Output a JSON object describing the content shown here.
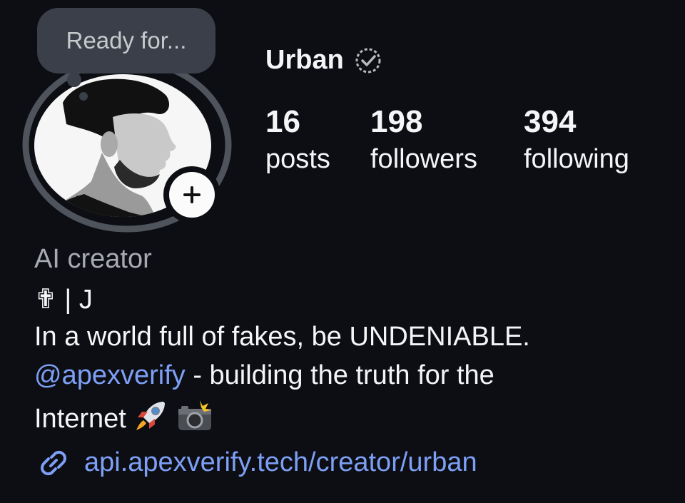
{
  "note": {
    "text": "Ready for..."
  },
  "profile": {
    "username": "Urban",
    "verified_icon": "verified-badge-icon",
    "stats": [
      {
        "value": "16",
        "label": "posts"
      },
      {
        "value": "198",
        "label": "followers"
      },
      {
        "value": "394",
        "label": "following"
      }
    ]
  },
  "bio": {
    "category": "AI creator",
    "line1": "✟ | J",
    "line2": "In a world full of fakes, be UNDENIABLE.",
    "line3_mention": "@apexverify",
    "line3_rest": " - building the truth for the",
    "line4": "Internet",
    "emojis": [
      "rocket-icon",
      "camera-flash-icon"
    ]
  },
  "link": {
    "icon": "link-icon",
    "text": "api.apexverify.tech/creator/urban"
  },
  "colors": {
    "background": "#0c0e13",
    "link": "#7d9ff5",
    "muted": "#a7aab0",
    "bubble": "#3a3f49"
  }
}
